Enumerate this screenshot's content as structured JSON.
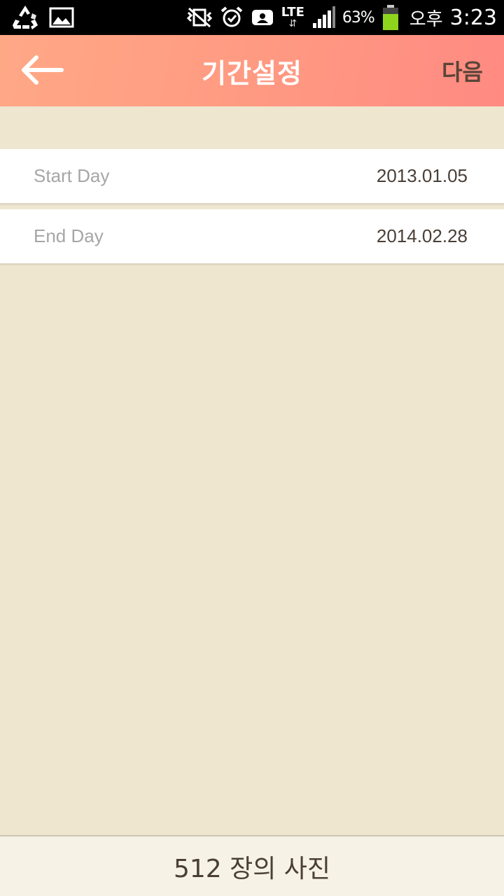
{
  "status_bar": {
    "battery_percent": "63%",
    "ampm": "오후",
    "time": "3:23",
    "network": "LTE",
    "icons": [
      "recycle-icon",
      "gallery-icon",
      "vibrate-off-icon",
      "alarm-icon",
      "contact-icon",
      "lte-icon",
      "signal-icon",
      "battery-icon"
    ]
  },
  "action_bar": {
    "title": "기간설정",
    "next_label": "다음",
    "back_icon": "arrow-left-icon"
  },
  "date_settings": {
    "start": {
      "label": "Start Day",
      "value": "2013.01.05"
    },
    "end": {
      "label": "End Day",
      "value": "2014.02.28"
    }
  },
  "footer": {
    "photo_count_text": "512 장의 사진"
  },
  "colors": {
    "header_gradient_start": "#ffa886",
    "header_gradient_end": "#ff8a82",
    "background": "#efe6d0",
    "battery": "#8ed61e"
  }
}
